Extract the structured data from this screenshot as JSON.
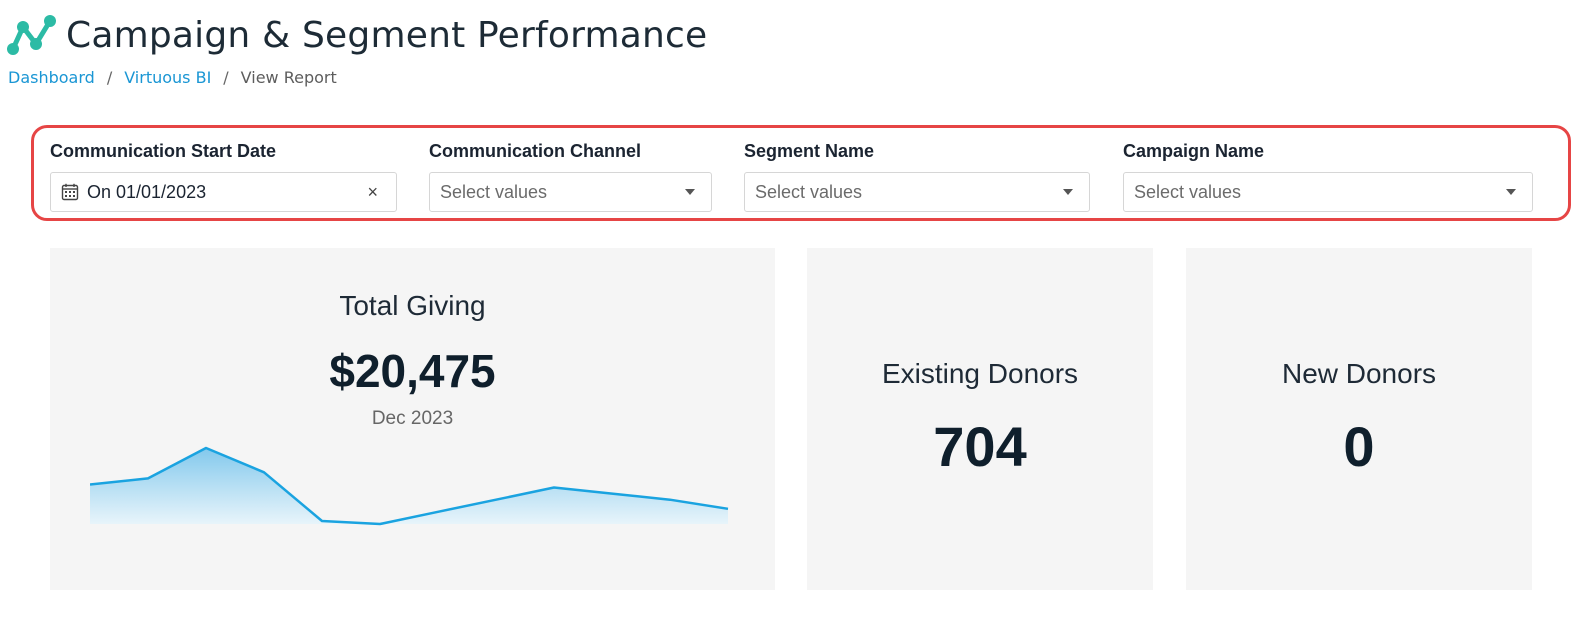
{
  "page": {
    "title": "Campaign & Segment Performance",
    "logo_icon": "line-chart-logo-icon",
    "accent_color": "#1a96d4",
    "logo_colors": [
      "#26b5a0",
      "#35c9b0"
    ]
  },
  "breadcrumb": {
    "items": [
      {
        "label": "Dashboard"
      },
      {
        "label": "Virtuous BI"
      },
      {
        "label": "View Report"
      }
    ],
    "separator": "/"
  },
  "filters": {
    "highlight_color": "#e64545",
    "start_date": {
      "label": "Communication Start Date",
      "value": "On 01/01/2023",
      "icon": "calendar-icon",
      "clear": "×"
    },
    "channel": {
      "label": "Communication Channel",
      "placeholder": "Select values"
    },
    "segment": {
      "label": "Segment Name",
      "placeholder": "Select values"
    },
    "campaign": {
      "label": "Campaign Name",
      "placeholder": "Select values"
    }
  },
  "cards": {
    "total_giving": {
      "title": "Total Giving",
      "value": "$20,475",
      "period": "Dec 2023",
      "sparkline_color": "#1aa3e0"
    },
    "existing_donors": {
      "title": "Existing Donors",
      "value": "704"
    },
    "new_donors": {
      "title": "New Donors",
      "value": "0"
    }
  },
  "chart_data": {
    "type": "area",
    "values": [
      4.5,
      5.5,
      10.5,
      6.5,
      -1.5,
      -2.0,
      0.0,
      2.0,
      4.0,
      3.0,
      2.0,
      0.5
    ],
    "title": "",
    "xlabel": "",
    "ylabel": "",
    "grid": false,
    "legend": "none"
  }
}
